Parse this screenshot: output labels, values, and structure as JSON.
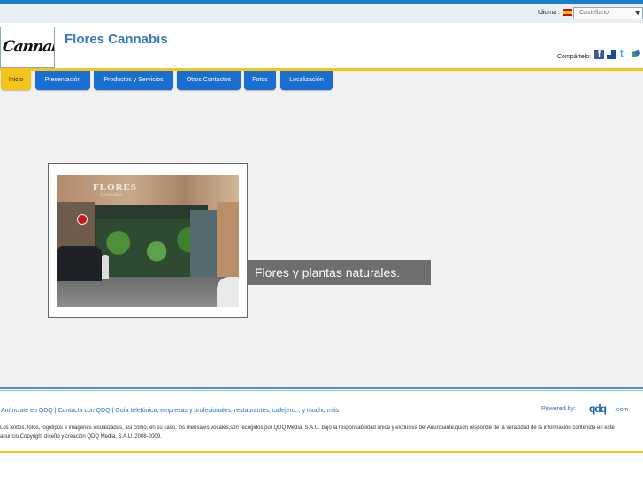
{
  "topbar": {
    "language_label": "Idioma :",
    "language_selected": "Castellano",
    "language_flag": "spain-flag-icon"
  },
  "header": {
    "logo_text": "Cannabis",
    "site_title": "Flores Cannabis",
    "share_label": "Compártelo:",
    "share_icons": [
      "facebook-icon",
      "delicious-icon",
      "twitter-icon",
      "other-share-icon"
    ]
  },
  "nav": {
    "items": [
      {
        "label": "Inicio",
        "active": true
      },
      {
        "label": "Presentación",
        "active": false
      },
      {
        "label": "Productos y Servicios",
        "active": false
      },
      {
        "label": "Otros Contactos",
        "active": false
      },
      {
        "label": "Fotos",
        "active": false
      },
      {
        "label": "Localización",
        "active": false
      }
    ]
  },
  "main": {
    "photo_sign": "FLORES",
    "photo_sign_sub": "Cannabis",
    "caption": "Flores y plantas naturales."
  },
  "footer": {
    "links": "Anúnciate en QDQ | Contacta con QDQ | Guía telefónica, empresas y profesionales, restaurantes, callejero... y mucho más",
    "powered_label": "Powered by:",
    "powered_brand": "qdq",
    "powered_domain": ".com",
    "legal": "Los textos, fotos, logotipos e imágenes visualizadas, así como, en su caso, los mensajes vocales,son recogidos por QDQ Media, S.A.U. bajo la responsabilidad única y exclusiva del Anunciante,quien responde de la veracidad de la información contenida en este anuncio.Copyright diseño y creación QDQ Media, S.A.U. 2008-2009."
  },
  "colors": {
    "brand_blue": "#1a6ed0",
    "accent_yellow": "#f5c51b",
    "title_blue": "#3878b8"
  }
}
